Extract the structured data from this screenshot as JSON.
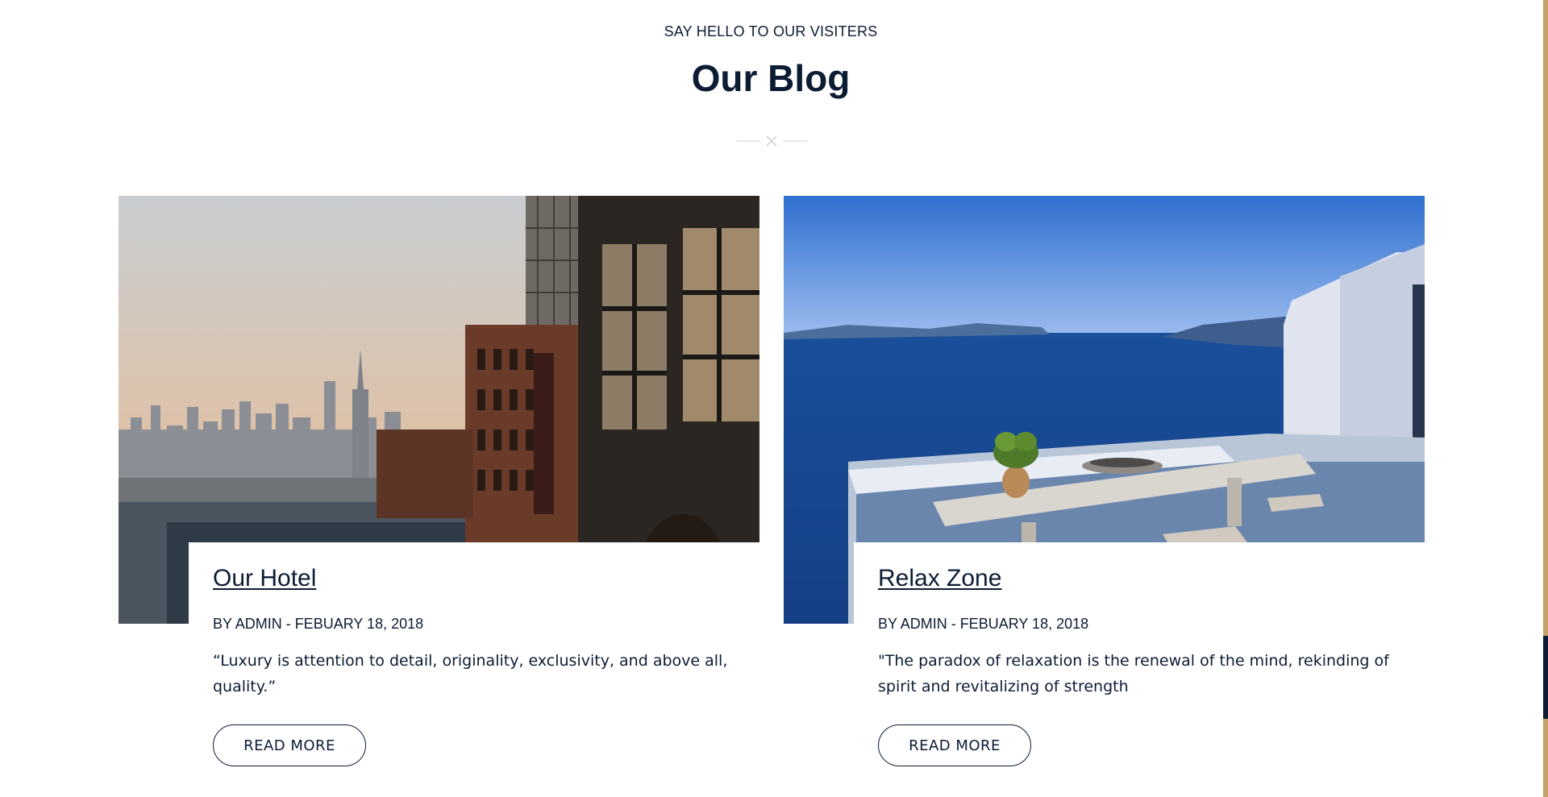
{
  "section": {
    "eyebrow": "SAY HELLO TO OUR VISITERS",
    "title": "Our Blog"
  },
  "posts": [
    {
      "title": "Our Hotel",
      "meta": "BY ADMIN - FEBUARY 18, 2018",
      "excerpt": "“Luxury is attention to detail, originality, exclusivity, and above all, quality.”",
      "button": "READ MORE"
    },
    {
      "title": "Relax Zone",
      "meta": "BY ADMIN - FEBUARY 18, 2018",
      "excerpt": "\"The paradox of relaxation is the renewal of the mind, rekinding of spirit and revitalizing of strength",
      "button": "READ MORE"
    }
  ],
  "colors": {
    "primary": "#0c1c33",
    "accent": "#c7a069",
    "divider": "#cccccc"
  }
}
